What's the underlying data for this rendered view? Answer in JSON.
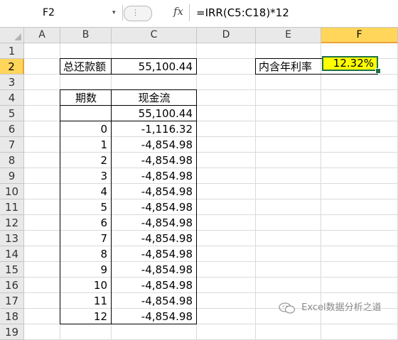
{
  "formula_bar": {
    "name_box": "F2",
    "name_box_arrow": "▾",
    "fx_label": "fx",
    "formula": "=IRR(C5:C18)*12"
  },
  "columns": [
    "A",
    "B",
    "C",
    "D",
    "E",
    "F"
  ],
  "rows": [
    "1",
    "2",
    "3",
    "4",
    "5",
    "6",
    "7",
    "8",
    "9",
    "10",
    "11",
    "12",
    "13",
    "14",
    "15",
    "16",
    "17",
    "18",
    "19"
  ],
  "selected_cell": "F2",
  "summary": {
    "label": "总还款额",
    "value": "55,100.44",
    "rate_label": "内含年利率",
    "rate_value": "12.32%"
  },
  "table": {
    "headers": [
      "期数",
      "现金流"
    ],
    "first_row": [
      "",
      "55,100.44"
    ],
    "periods": [
      "0",
      "1",
      "2",
      "3",
      "4",
      "5",
      "6",
      "7",
      "8",
      "9",
      "10",
      "11",
      "12"
    ],
    "flows": [
      "-1,116.32",
      "-4,854.98",
      "-4,854.98",
      "-4,854.98",
      "-4,854.98",
      "-4,854.98",
      "-4,854.98",
      "-4,854.98",
      "-4,854.98",
      "-4,854.98",
      "-4,854.98",
      "-4,854.98",
      "-4,854.98"
    ]
  },
  "colors": {
    "highlight_fill": "#ffff00",
    "selection_border": "#1e7145",
    "header_selected": "#ffd55a"
  },
  "watermark": "Excel数据分析之道"
}
